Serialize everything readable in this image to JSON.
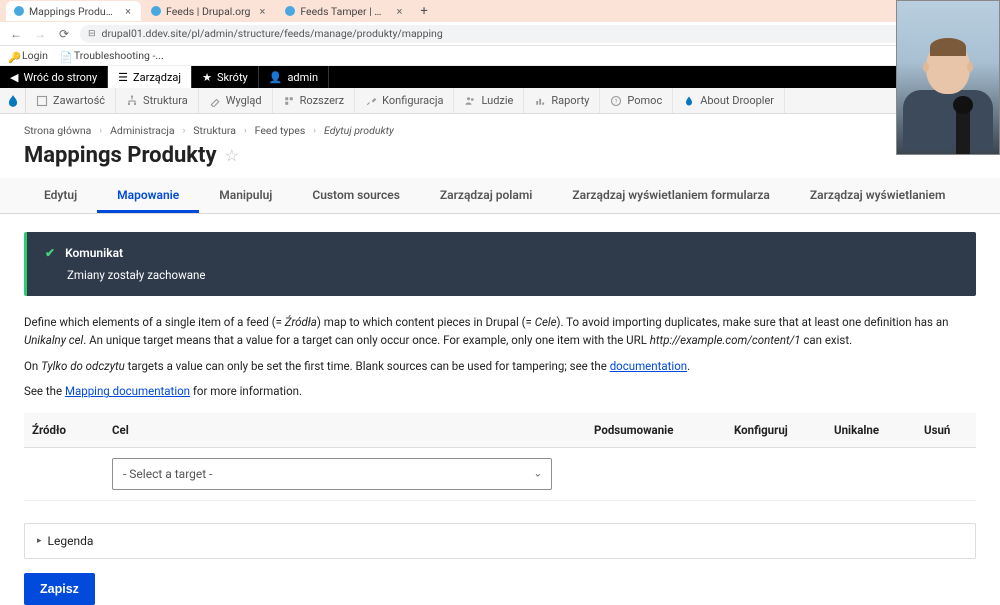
{
  "browser": {
    "tabs": [
      {
        "title": "Mappings Produkty | droopler",
        "favicon": "fav-blue"
      },
      {
        "title": "Feeds | Drupal.org",
        "favicon": "fav-blue"
      },
      {
        "title": "Feeds Tamper | Drupal.org",
        "favicon": "fav-blue"
      }
    ],
    "url": "drupal01.ddev.site/pl/admin/structure/feeds/manage/produkty/mapping",
    "bookmarks": [
      {
        "label": "Login"
      },
      {
        "label": "Troubleshooting -..."
      }
    ]
  },
  "admin_top": {
    "back": "Wróć do strony",
    "manage": "Zarządzaj",
    "shortcuts": "Skróty",
    "user": "admin"
  },
  "admin_sub": [
    "Zawartość",
    "Struktura",
    "Wygląd",
    "Rozszerz",
    "Konfiguracja",
    "Ludzie",
    "Raporty",
    "Pomoc",
    "About Droopler"
  ],
  "breadcrumbs": [
    "Strona główna",
    "Administracja",
    "Struktura",
    "Feed types",
    "Edytuj produkty"
  ],
  "page_title": "Mappings Produkty",
  "tabs": [
    {
      "label": "Edytuj",
      "active": false
    },
    {
      "label": "Mapowanie",
      "active": true
    },
    {
      "label": "Manipuluj",
      "active": false
    },
    {
      "label": "Custom sources",
      "active": false
    },
    {
      "label": "Zarządzaj polami",
      "active": false
    },
    {
      "label": "Zarządzaj wyświetlaniem formularza",
      "active": false
    },
    {
      "label": "Zarządzaj wyświetlaniem",
      "active": false
    }
  ],
  "status": {
    "heading": "Komunikat",
    "body": "Zmiany zostały zachowane"
  },
  "desc": {
    "p1a": "Define which elements of a single item of a feed (= ",
    "p1b": "Źródła",
    "p1c": ") map to which content pieces in Drupal (= ",
    "p1d": "Cele",
    "p1e": "). To avoid importing duplicates, make sure that at least one definition has an ",
    "p1f": "Unikalny cel",
    "p1g": ". An unique target means that a value for a target can only occur once. For example, only one item with the URL ",
    "p1h": "http://example.com/content/1",
    "p1i": " can exist.",
    "p2a": "On ",
    "p2b": "Tylko do odczytu",
    "p2c": " targets a value can only be set the first time. Blank sources can be used for tampering; see the ",
    "p2d": "documentation",
    "p3a": "See the ",
    "p3b": "Mapping documentation",
    "p3c": " for more information."
  },
  "table": {
    "headers": [
      "Źródło",
      "Cel",
      "Podsumowanie",
      "Konfiguruj",
      "Unikalne",
      "Usuń"
    ],
    "select_placeholder": "- Select a target -"
  },
  "legend_label": "Legenda",
  "save_label": "Zapisz"
}
